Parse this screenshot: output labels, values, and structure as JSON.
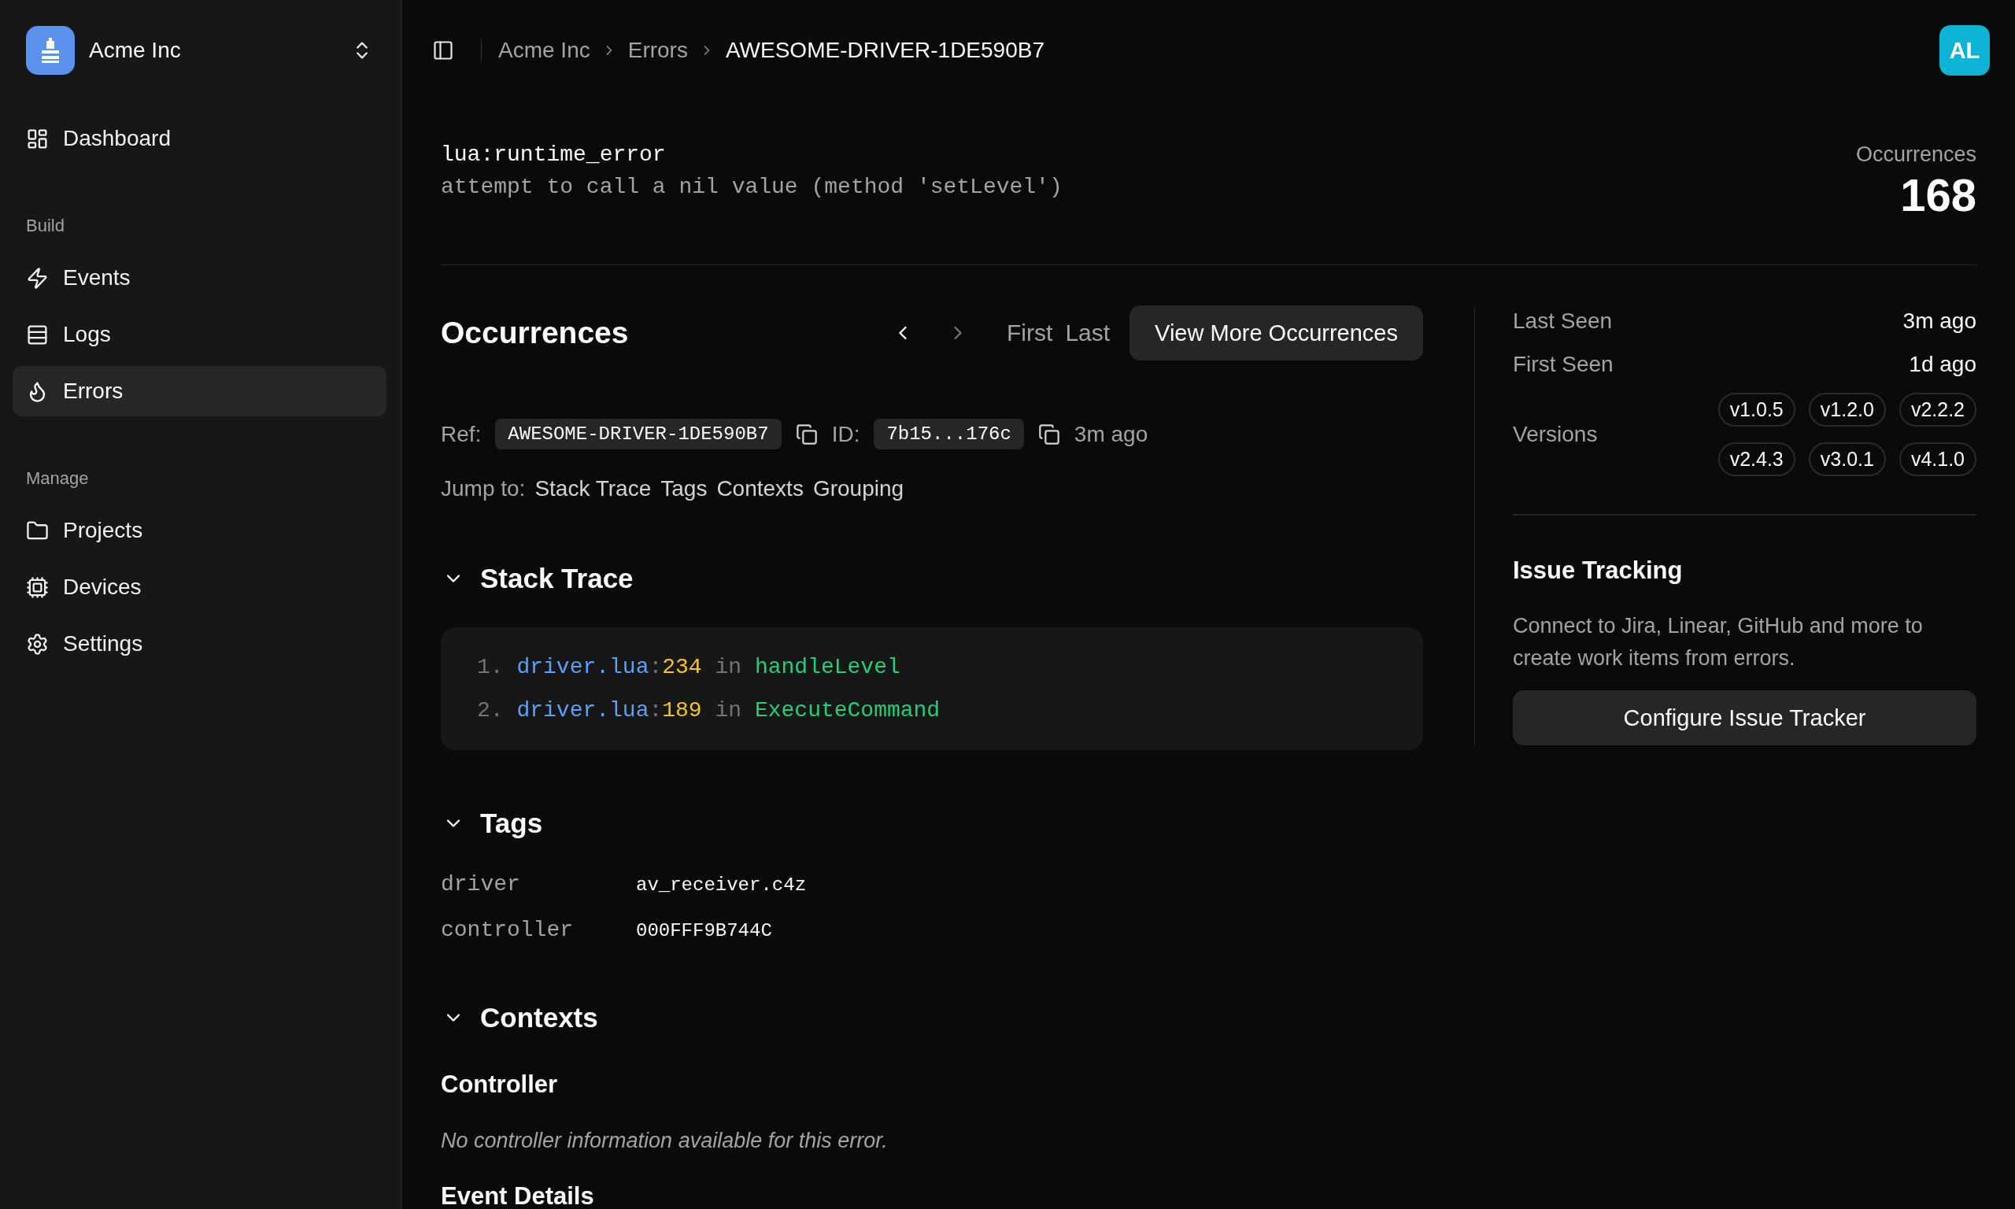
{
  "sidebar": {
    "org": {
      "name": "Acme Inc"
    },
    "groups": [
      {
        "items": [
          {
            "label": "Dashboard",
            "selected": false
          }
        ]
      },
      {
        "title": "Build",
        "items": [
          {
            "label": "Events",
            "selected": false
          },
          {
            "label": "Logs",
            "selected": false
          },
          {
            "label": "Errors",
            "selected": true
          }
        ]
      },
      {
        "title": "Manage",
        "items": [
          {
            "label": "Projects",
            "selected": false
          },
          {
            "label": "Devices",
            "selected": false
          },
          {
            "label": "Settings",
            "selected": false
          }
        ]
      }
    ]
  },
  "header": {
    "breadcrumbs": [
      "Acme Inc",
      "Errors",
      "AWESOME-DRIVER-1DE590B7"
    ],
    "avatar": "AL"
  },
  "error": {
    "type": "lua:runtime_error",
    "message": "attempt to call a nil value (method 'setLevel')",
    "count_label": "Occurrences",
    "count": "168"
  },
  "occurrences": {
    "title": "Occurrences",
    "pager": [
      {
        "kind": "prev",
        "disabled": false
      },
      {
        "kind": "next",
        "disabled": true
      }
    ],
    "jumps": [
      "First",
      "Last"
    ],
    "button": "View More Occurrences",
    "ref_label": "Ref:",
    "ref": "AWESOME-DRIVER-1DE590B7",
    "id_label": "ID:",
    "id": "7b15...176c",
    "time": "3m ago"
  },
  "jump_to": {
    "label": "Jump to:",
    "links": [
      "Stack Trace",
      "Tags",
      "Contexts",
      "Grouping"
    ]
  },
  "stack_trace": {
    "title": "Stack Trace",
    "expanded": true,
    "frames": [
      {
        "number": "1.",
        "file": "driver.lua",
        "separator": ":",
        "line": "234",
        "keyword": "in",
        "function": "handleLevel"
      },
      {
        "number": "2.",
        "file": "driver.lua",
        "separator": ":",
        "line": "189",
        "keyword": "in",
        "function": "ExecuteCommand"
      }
    ]
  },
  "tags": {
    "title": "Tags",
    "expanded": true,
    "rows": [
      {
        "key": "driver",
        "value": "av_receiver.c4z"
      },
      {
        "key": "controller",
        "value": "000FFF9B744C"
      }
    ]
  },
  "contexts": {
    "title": "Contexts",
    "expanded": true,
    "groups": [
      {
        "title": "Controller",
        "message": "No controller information available for this error."
      }
    ]
  },
  "event_details": {
    "title": "Event Details"
  },
  "summary": {
    "rows": [
      {
        "label": "Last Seen",
        "value": "3m ago"
      },
      {
        "label": "First Seen",
        "value": "1d ago"
      }
    ],
    "versions_label": "Versions",
    "versions": [
      "v1.0.5",
      "v1.2.0",
      "v2.2.2",
      "v2.4.3",
      "v3.0.1",
      "v4.1.0"
    ]
  },
  "issue_tracking": {
    "title": "Issue Tracking",
    "description": "Connect to Jira, Linear, GitHub and more to create work items from errors.",
    "button": "Configure Issue Tracker"
  }
}
